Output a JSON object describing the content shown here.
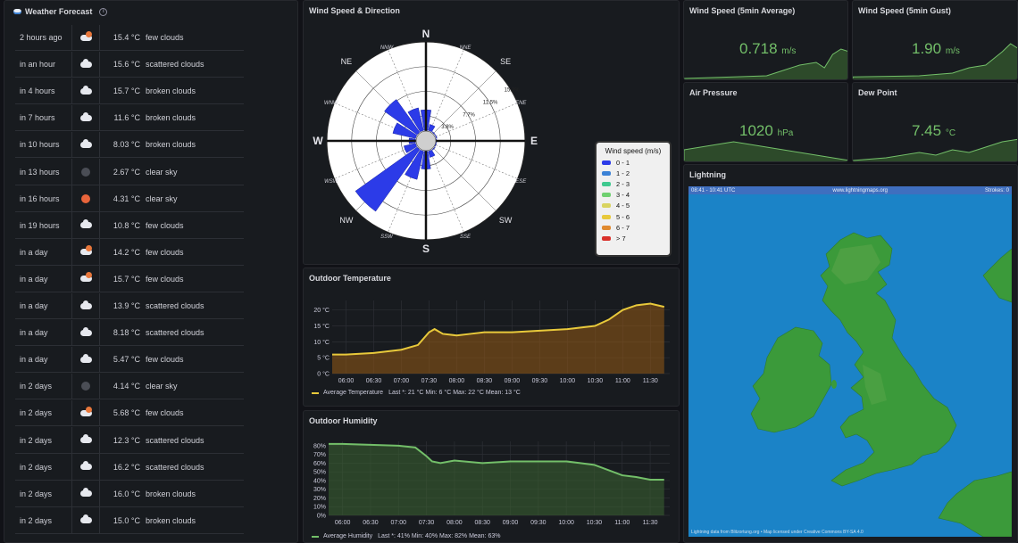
{
  "forecast": {
    "title": "Weather Forecast",
    "rows": [
      {
        "time": "2 hours ago",
        "icon": "few-clouds",
        "temp": "15.4 °C",
        "desc": "few clouds"
      },
      {
        "time": "in an hour",
        "icon": "cloud",
        "temp": "15.6 °C",
        "desc": "scattered clouds"
      },
      {
        "time": "in 4 hours",
        "icon": "cloud",
        "temp": "15.7 °C",
        "desc": "broken clouds"
      },
      {
        "time": "in 7 hours",
        "icon": "cloud",
        "temp": "11.6 °C",
        "desc": "broken clouds"
      },
      {
        "time": "in 10 hours",
        "icon": "cloud",
        "temp": "8.03 °C",
        "desc": "broken clouds"
      },
      {
        "time": "in 13 hours",
        "icon": "moon",
        "temp": "2.67 °C",
        "desc": "clear sky"
      },
      {
        "time": "in 16 hours",
        "icon": "sun",
        "temp": "4.31 °C",
        "desc": "clear sky"
      },
      {
        "time": "in 19 hours",
        "icon": "cloud",
        "temp": "10.8 °C",
        "desc": "few clouds"
      },
      {
        "time": "in a day",
        "icon": "few-clouds",
        "temp": "14.2 °C",
        "desc": "few clouds"
      },
      {
        "time": "in a day",
        "icon": "few-clouds",
        "temp": "15.7 °C",
        "desc": "few clouds"
      },
      {
        "time": "in a day",
        "icon": "cloud",
        "temp": "13.9 °C",
        "desc": "scattered clouds"
      },
      {
        "time": "in a day",
        "icon": "cloud",
        "temp": "8.18 °C",
        "desc": "scattered clouds"
      },
      {
        "time": "in a day",
        "icon": "cloud",
        "temp": "5.47 °C",
        "desc": "few clouds"
      },
      {
        "time": "in 2 days",
        "icon": "moon",
        "temp": "4.14 °C",
        "desc": "clear sky"
      },
      {
        "time": "in 2 days",
        "icon": "few-clouds",
        "temp": "5.68 °C",
        "desc": "few clouds"
      },
      {
        "time": "in 2 days",
        "icon": "cloud",
        "temp": "12.3 °C",
        "desc": "scattered clouds"
      },
      {
        "time": "in 2 days",
        "icon": "cloud",
        "temp": "16.2 °C",
        "desc": "scattered clouds"
      },
      {
        "time": "in 2 days",
        "icon": "cloud",
        "temp": "16.0 °C",
        "desc": "broken clouds"
      },
      {
        "time": "in 2 days",
        "icon": "cloud",
        "temp": "15.0 °C",
        "desc": "broken clouds"
      }
    ]
  },
  "wind_rose": {
    "title": "Wind Speed & Direction",
    "cardinals": [
      "N",
      "E",
      "S",
      "W"
    ],
    "intercardinals": [
      "NE",
      "SE",
      "SW",
      "NW"
    ],
    "minor": [
      "NNE",
      "ENE",
      "ESE",
      "SSE",
      "SSW",
      "WSW",
      "WNW",
      "NNW"
    ],
    "ring_labels": [
      "3.8%",
      "7.7%",
      "11.5%",
      "15.3%"
    ],
    "legend_title": "Wind speed (m/s)",
    "legend": [
      {
        "label": "0 - 1",
        "color": "#2c3be8"
      },
      {
        "label": "1 - 2",
        "color": "#3b82d6"
      },
      {
        "label": "2 - 3",
        "color": "#3fc98f"
      },
      {
        "label": "3 - 4",
        "color": "#6fd070"
      },
      {
        "label": "4 - 5",
        "color": "#d9d460"
      },
      {
        "label": "5 - 6",
        "color": "#e8c93b"
      },
      {
        "label": "6 - 7",
        "color": "#e08a2f"
      },
      {
        "label": "> 7",
        "color": "#d9312b"
      }
    ]
  },
  "stats": {
    "wind_avg": {
      "title": "Wind Speed (5min Average)",
      "value": "0.718",
      "unit": "m/s"
    },
    "wind_gust": {
      "title": "Wind Speed (5min Gust)",
      "value": "1.90",
      "unit": "m/s"
    },
    "pressure": {
      "title": "Air Pressure",
      "value": "1020",
      "unit": "hPa"
    },
    "dew": {
      "title": "Dew Point",
      "value": "7.45",
      "unit": "°C"
    }
  },
  "lightning": {
    "title": "Lightning",
    "time_range": "08:41 - 10:41 UTC",
    "site": "www.lightningmaps.org",
    "strokes": "Strokes: 0",
    "footer": "Lightning data from Blitzortung.org  •  Map licensed under Creative Commons BY-SA 4.0"
  },
  "temperature": {
    "title": "Outdoor Temperature",
    "legend_name": "Average Temperature",
    "legend_stats": "Last *: 21 °C   Min: 6 °C   Max: 22 °C   Mean: 13 °C",
    "color": "#e8c93b"
  },
  "humidity": {
    "title": "Outdoor Humidity",
    "legend_name": "Average Humidity",
    "legend_stats": "Last *: 41%   Min: 40%   Max: 82%   Mean: 63%",
    "color": "#73bf69"
  },
  "chart_data": [
    {
      "type": "area",
      "title": "Outdoor Temperature",
      "x_ticks": [
        "06:00",
        "06:30",
        "07:00",
        "07:30",
        "08:00",
        "08:30",
        "09:00",
        "09:30",
        "10:00",
        "10:30",
        "11:00",
        "11:30"
      ],
      "y_ticks": [
        "0 °C",
        "5 °C",
        "10 °C",
        "15 °C",
        "20 °C"
      ],
      "ylim": [
        0,
        23
      ],
      "series": [
        {
          "name": "Average Temperature",
          "x": [
            5.75,
            6.0,
            6.5,
            7.0,
            7.3,
            7.5,
            7.6,
            7.75,
            8.0,
            8.25,
            8.5,
            9.0,
            9.5,
            10.0,
            10.5,
            10.75,
            11.0,
            11.25,
            11.5,
            11.75
          ],
          "values": [
            6,
            6,
            6.5,
            7.5,
            9,
            13,
            14,
            12.5,
            12,
            12.5,
            13,
            13,
            13.5,
            14,
            15,
            17,
            20,
            21.5,
            22,
            21
          ]
        }
      ]
    },
    {
      "type": "area",
      "title": "Outdoor Humidity",
      "x_ticks": [
        "06:00",
        "06:30",
        "07:00",
        "07:30",
        "08:00",
        "08:30",
        "09:00",
        "09:30",
        "10:00",
        "10:30",
        "11:00",
        "11:30"
      ],
      "y_ticks": [
        "0%",
        "10%",
        "20%",
        "30%",
        "40%",
        "50%",
        "60%",
        "70%",
        "80%"
      ],
      "ylim": [
        0,
        85
      ],
      "series": [
        {
          "name": "Average Humidity",
          "x": [
            5.75,
            6.0,
            6.5,
            7.0,
            7.3,
            7.5,
            7.6,
            7.75,
            8.0,
            8.5,
            9.0,
            9.5,
            10.0,
            10.25,
            10.5,
            10.75,
            11.0,
            11.25,
            11.5,
            11.75
          ],
          "values": [
            82,
            82,
            81,
            80,
            78,
            68,
            62,
            60,
            63,
            60,
            62,
            62,
            62,
            60,
            58,
            52,
            46,
            44,
            41,
            41
          ]
        }
      ]
    },
    {
      "type": "bar",
      "title": "Wind Speed & Direction",
      "categories": [
        "N",
        "NNE",
        "NE",
        "ENE",
        "E",
        "ESE",
        "SE",
        "SSE",
        "S",
        "SSW",
        "SW",
        "WSW",
        "W",
        "WNW",
        "NW",
        "NNW"
      ],
      "values": [
        5.5,
        3,
        2,
        2,
        1.5,
        1.5,
        2,
        3,
        5,
        7,
        15.3,
        4,
        3,
        6,
        9,
        6
      ]
    }
  ]
}
